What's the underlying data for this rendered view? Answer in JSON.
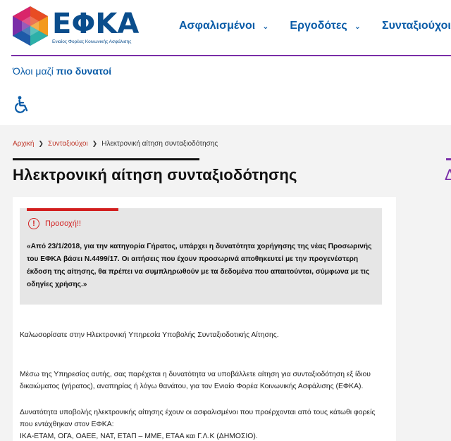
{
  "brand": {
    "name": "ΕΦΚΑ",
    "subtitle": "Ενιαίος Φορέας Κοινωνικής Ασφάλισης",
    "colors": {
      "primary": "#0a5ca8",
      "accent": "#7a2ea8",
      "alert": "#d21f1f"
    }
  },
  "nav": {
    "items": [
      {
        "label": "Ασφαλισμένοι",
        "icon": "chevron-down-icon"
      },
      {
        "label": "Εργοδότες",
        "icon": "chevron-down-icon"
      },
      {
        "label": "Συνταξιούχοι",
        "icon": "chevron-down-icon"
      }
    ]
  },
  "slogan": {
    "normal": "Όλοι μαζί ",
    "bold": "πιο δυνατοί"
  },
  "accessibility": {
    "icon": "wheelchair-icon"
  },
  "breadcrumb": {
    "home": "Αρχική",
    "parent": "Συνταξιούχοι",
    "current": "Ηλεκτρονική αίτηση συνταξιοδότησης"
  },
  "page": {
    "title": "Ηλεκτρονική αίτηση συνταξιοδότησης"
  },
  "alert": {
    "title": "Προσοχή!!",
    "icon": "exclamation-circle-icon",
    "body": "«Από 23/1/2018, για την κατηγορία Γήρατος, υπάρχει η δυνατότητα χορήγησης της νέας Προσωρινής του ΕΦΚΑ βάσει Ν.4499/17. Οι αιτήσεις που έχουν προσωρινά αποθηκευτεί με την προγενέστερη έκδοση της αίτησης, θα πρέπει να συμπληρωθούν με τα δεδομένα που απαιτούνται, σύμφωνα με τις οδηγίες χρήσης.»"
  },
  "content": {
    "p1": "Καλωσορίσατε στην Ηλεκτρονική Υπηρεσία Υποβολής Συνταξιοδοτικής Αίτησης.",
    "p2": "Μέσω της Υπηρεσίας αυτής, σας παρέχεται η δυνατότητα να υποβάλλετε αίτηση για συνταξιοδότηση εξ ίδιου δικαιώματος (γήρατος), αναπηρίας ή λόγω θανάτου, για τον Ενιαίο Φορέα Κοινωνικής Ασφάλισης (ΕΦΚΑ).",
    "p3a": "Δυνατότητα υποβολής ηλεκτρονικής αίτησης έχουν οι ασφαλισμένοι που προέρχονται από τους κάτωθι φορείς που εντάχθηκαν στον ΕΦΚΑ:",
    "p3b": "ΙΚΑ-ΕΤΑΜ, ΟΓΑ, ΟΑΕΕ, ΝΑΤ, ΕΤΑΠ – ΜΜΕ, ΕΤΑΑ και Γ.Λ.Κ (ΔΗΜΟΣΙΟ)."
  }
}
